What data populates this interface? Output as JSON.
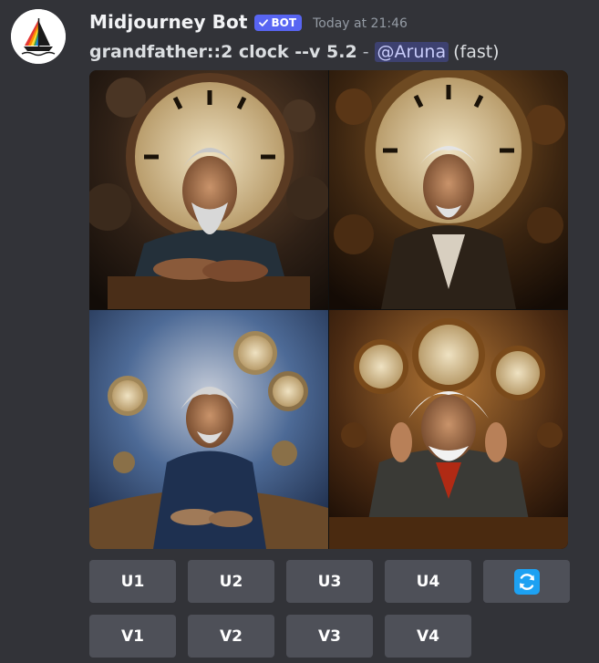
{
  "message": {
    "author": "Midjourney Bot",
    "badge": "BOT",
    "timestamp": "Today at 21:46",
    "prompt": "grandfather::2 clock --v 5.2",
    "separator": "-",
    "mention": "@Aruna",
    "speed": "(fast)"
  },
  "buttons": {
    "upscale": [
      "U1",
      "U2",
      "U3",
      "U4"
    ],
    "variation": [
      "V1",
      "V2",
      "V3",
      "V4"
    ],
    "reroll_icon": "refresh-icon"
  },
  "colors": {
    "background": "#323338",
    "button": "#4e5058",
    "badge": "#5865f2",
    "mention_bg": "rgba(88,101,242,0.3)",
    "reroll_blue": "#1da1f2"
  }
}
